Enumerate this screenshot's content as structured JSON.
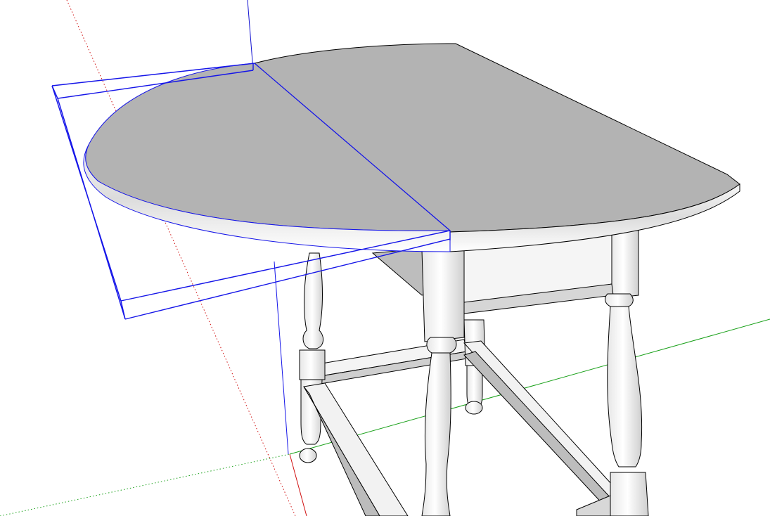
{
  "app": {
    "description_visible_text": ""
  },
  "viewport": {
    "background_color": "#ffffff",
    "axis_colors": {
      "red": "#d01010",
      "green": "#18a018",
      "blue": "#1010d0"
    },
    "selection_color": "#1515e8",
    "face_color": "#b3b3b3",
    "edge_color": "#000000",
    "model": "drop-leaf-gateleg-table",
    "selected_component": "drop-leaf",
    "show_axes": true
  }
}
